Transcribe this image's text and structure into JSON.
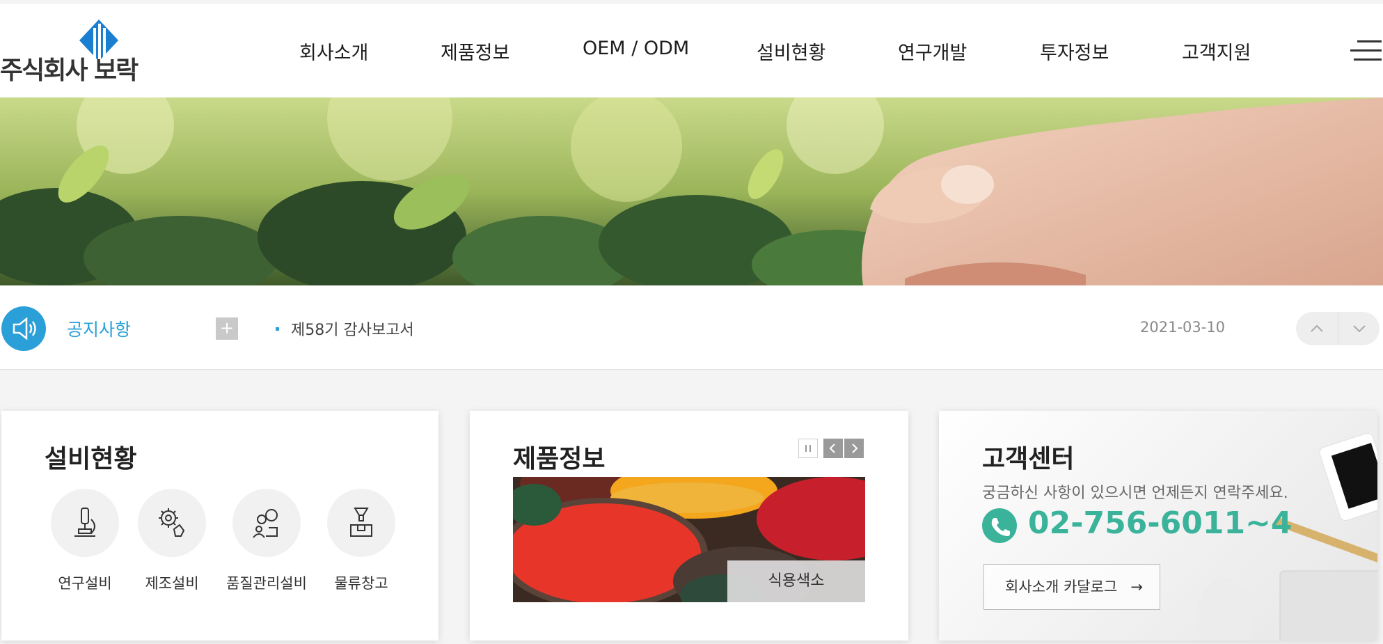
{
  "logo": {
    "text": "주식회사 보락"
  },
  "nav": {
    "items": [
      "회사소개",
      "제품정보",
      "OEM / ODM",
      "설비현황",
      "연구개발",
      "투자정보",
      "고객지원"
    ],
    "menu_icon": "hamburger-icon"
  },
  "notice": {
    "label": "공지사항",
    "more": "+",
    "title": "제58기 감사보고서",
    "date": "2021-03-10",
    "icon": "speaker-icon"
  },
  "facilities": {
    "title": "설비현황",
    "items": [
      {
        "label": "연구설비",
        "icon": "microscope-icon"
      },
      {
        "label": "제조설비",
        "icon": "gear-hand-icon"
      },
      {
        "label": "품질관리설비",
        "icon": "gears-person-icon"
      },
      {
        "label": "물류창고",
        "icon": "warehouse-box-icon"
      }
    ]
  },
  "products": {
    "title": "제품정보",
    "caption": "식용색소"
  },
  "customer": {
    "title": "고객센터",
    "subtitle": "궁금하신 사항이 있으시면 언제든지 연락주세요.",
    "phone": "02-756-6011~4",
    "catalog_button": "회사소개 카달로그",
    "button_arrow": "→"
  },
  "colors": {
    "accent_blue": "#2a9fd8",
    "accent_green": "#3bb39b"
  }
}
